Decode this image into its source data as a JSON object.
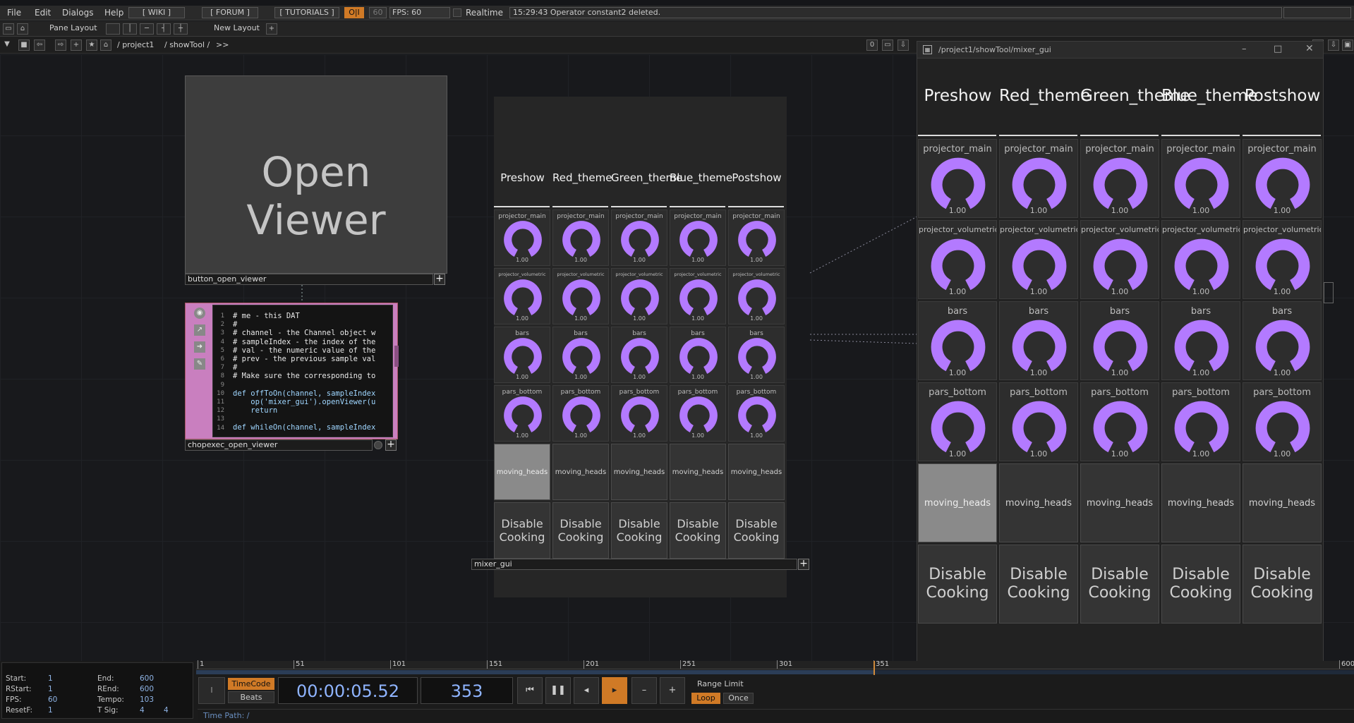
{
  "menu": {
    "file": "File",
    "edit": "Edit",
    "dialogs": "Dialogs",
    "help": "Help",
    "wiki": "[ WIKI ]",
    "forum": "[ FORUM ]",
    "tutorials": "[ TUTORIALS ]",
    "oi": "O|I",
    "fps_box": "60",
    "fps_label": "FPS: 60",
    "realtime": "Realtime",
    "status": "15:29:43 Operator constant2 deleted."
  },
  "toolbar": {
    "pane_layout": "Pane Layout",
    "new_layout": "New Layout",
    "path_project": "/ project1",
    "path_showtool": "/ showTool /",
    "path_more": ">>",
    "zero": "0"
  },
  "button_node": {
    "text": "Open Viewer",
    "label": "button_open_viewer"
  },
  "chop_node": {
    "label": "chopexec_open_viewer",
    "line_numbers": [
      "1",
      "2",
      "3",
      "4",
      "5",
      "6",
      "7",
      "8",
      "9",
      "10",
      "11",
      "12",
      "13",
      "14"
    ],
    "lines": [
      "# me - this DAT",
      "#",
      "# channel - the Channel object w",
      "# sampleIndex - the index of the",
      "# val - the numeric value of the",
      "# prev - the previous sample val",
      "#",
      "# Make sure the corresponding to",
      "",
      "def offToOn(channel, sampleIndex",
      "    op('mixer_gui').openViewer(u",
      "    return",
      "",
      "def whileOn(channel, sampleIndex"
    ]
  },
  "mixer": {
    "columns": [
      "Preshow",
      "Red_theme",
      "Green_theme",
      "Blue_theme",
      "Postshow"
    ],
    "knob_rows": [
      "projector_main",
      "projector_volumetric",
      "bars",
      "pars_bottom"
    ],
    "knob_value": "1.00",
    "toggle_label": "moving_heads",
    "disable_line1": "Disable",
    "disable_line2": "Cooking",
    "node_label": "mixer_gui",
    "knob_color": "#b37aff"
  },
  "viewer": {
    "title": "/project1/showTool/mixer_gui"
  },
  "timeline": {
    "ticks": [
      "1",
      "51",
      "101",
      "151",
      "201",
      "251",
      "301",
      "351",
      "600"
    ],
    "start_k": "Start:",
    "start_v": "1",
    "end_k": "End:",
    "end_v": "600",
    "rstart_k": "RStart:",
    "rstart_v": "1",
    "rend_k": "REnd:",
    "rend_v": "600",
    "fps_k": "FPS:",
    "fps_v": "60",
    "tempo_k": "Tempo:",
    "tempo_v": "103",
    "resetf_k": "ResetF:",
    "resetf_v": "1",
    "tsig_k": "T Sig:",
    "tsig_v1": "4",
    "tsig_v2": "4",
    "timecode": "TimeCode",
    "beats": "Beats",
    "time": "00:00:05.52",
    "frame": "353",
    "range_limit": "Range Limit",
    "loop": "Loop",
    "once": "Once",
    "time_path": "Time Path: /",
    "i_label": "I"
  }
}
